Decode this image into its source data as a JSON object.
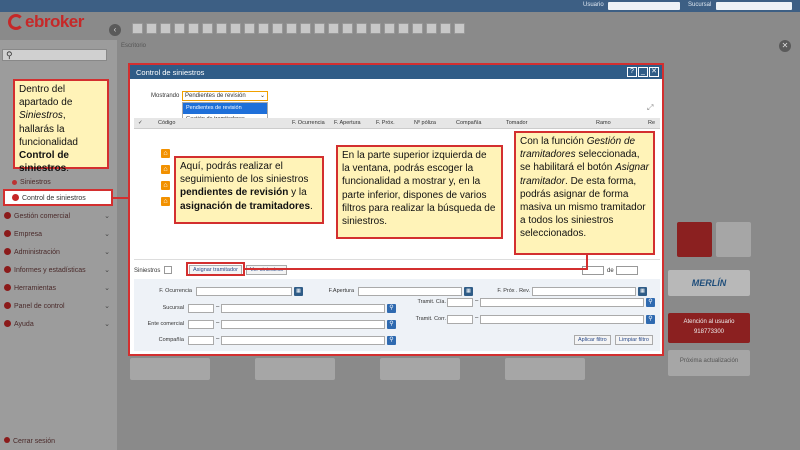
{
  "app": {
    "brand": "ebroker"
  },
  "topbar": {
    "usuario_label": "Usuario",
    "sucursal_label": "Sucursal"
  },
  "sidebar": {
    "search_placeholder": "",
    "items": [
      {
        "label": "Siniestros"
      },
      {
        "label": "Control de siniestros"
      },
      {
        "label": "Gestión comercial"
      },
      {
        "label": "Empresa"
      },
      {
        "label": "Administración"
      },
      {
        "label": "Informes y estadísticas"
      },
      {
        "label": "Herramientas"
      },
      {
        "label": "Panel de control"
      },
      {
        "label": "Ayuda"
      }
    ],
    "logout": "Cerrar sesión"
  },
  "desktop": {
    "escritorio": "Escritorio",
    "tile_merlin": "MERLÍN",
    "tile_contact": "Atención al usuario",
    "tile_phone": "918773300",
    "tile_next": "Próxima actualización"
  },
  "modal": {
    "title": "Control de siniestros",
    "mostrando_label": "Mostrando",
    "mostrando_value": "Pendientes de revisión",
    "dropdown_options": [
      "Pendientes de revisión",
      "Gestión de tramitadores"
    ],
    "columns": [
      "Código",
      "F. Ocurrencia",
      "F. Apertura",
      "F. Próx.",
      "Nº póliza",
      "Compañía",
      "Tomador",
      "Ramo",
      "Re"
    ],
    "siniestros_label": "Siniestros",
    "btn_asignar": "Asignar tramitador",
    "btn_ver": "Ver siniestros",
    "pager_de": "de",
    "filters": {
      "f_ocurrencia": "F. Ocurrencia",
      "f_apertura": "F.Apertura",
      "f_prox_rev": "F. Próx . Rev.",
      "sucursal": "Sucursal",
      "tramit_cia": "Tramit. Cía.",
      "ente_comercial": "Ente comercial",
      "tramit_corr": "Tramit. Corr.",
      "compania": "Compañía",
      "btn_aplicar": "Aplicar filtro",
      "btn_limpiar": "Limpiar filtro"
    }
  },
  "callouts": {
    "c1": {
      "p1": "Dentro del apartado de ",
      "i1": "Siniestros",
      "p2": ", hallarás la funcionalidad ",
      "b1": "Control de siniestros",
      "p3": "."
    },
    "c2": {
      "p1": "Aquí, podrás realizar el seguimiento de los siniestros ",
      "b1": "pendientes de revisión",
      "p2": " y la ",
      "b2": "asignación de tramitadores",
      "p3": "."
    },
    "c3": {
      "text": "En la parte superior izquierda de la ventana, podrás escoger la funcionalidad a mostrar y, en la parte inferior, dispones de varios filtros para realizar la búsqueda de siniestros."
    },
    "c4": {
      "p1": "Con la función ",
      "i1": "Gestión de tramitadores",
      "p2": " seleccionada, se habilitará el botón ",
      "i2": "Asignar tramitador",
      "p3": ". De esta forma, podrás asignar de forma masiva un mismo tramitador a todos los siniestros seleccionados."
    }
  }
}
